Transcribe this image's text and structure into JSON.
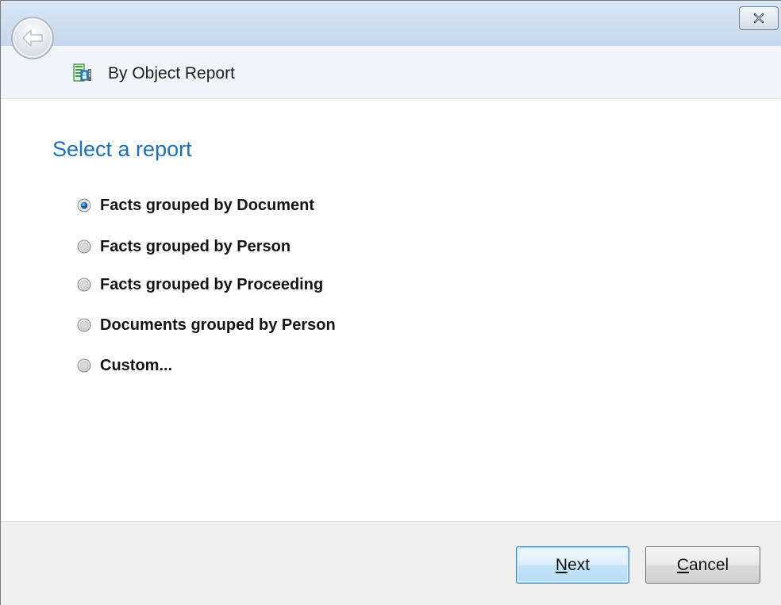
{
  "window": {
    "close_glyph": "close-icon"
  },
  "nav": {
    "title": "By Object Report",
    "back_icon": "back-arrow-icon",
    "app_icon": "report-icon"
  },
  "main": {
    "heading": "Select a report",
    "options": [
      {
        "label": "Facts grouped by Document",
        "selected": true
      },
      {
        "label": "Facts grouped by Person",
        "selected": false
      },
      {
        "label": "Facts grouped by Proceeding",
        "selected": false
      },
      {
        "label": "Documents grouped by Person",
        "selected": false
      },
      {
        "label": "Custom...",
        "selected": false
      }
    ]
  },
  "footer": {
    "next_mnemonic": "N",
    "next_rest": "ext",
    "cancel_mnemonic": "C",
    "cancel_rest": "ancel"
  }
}
